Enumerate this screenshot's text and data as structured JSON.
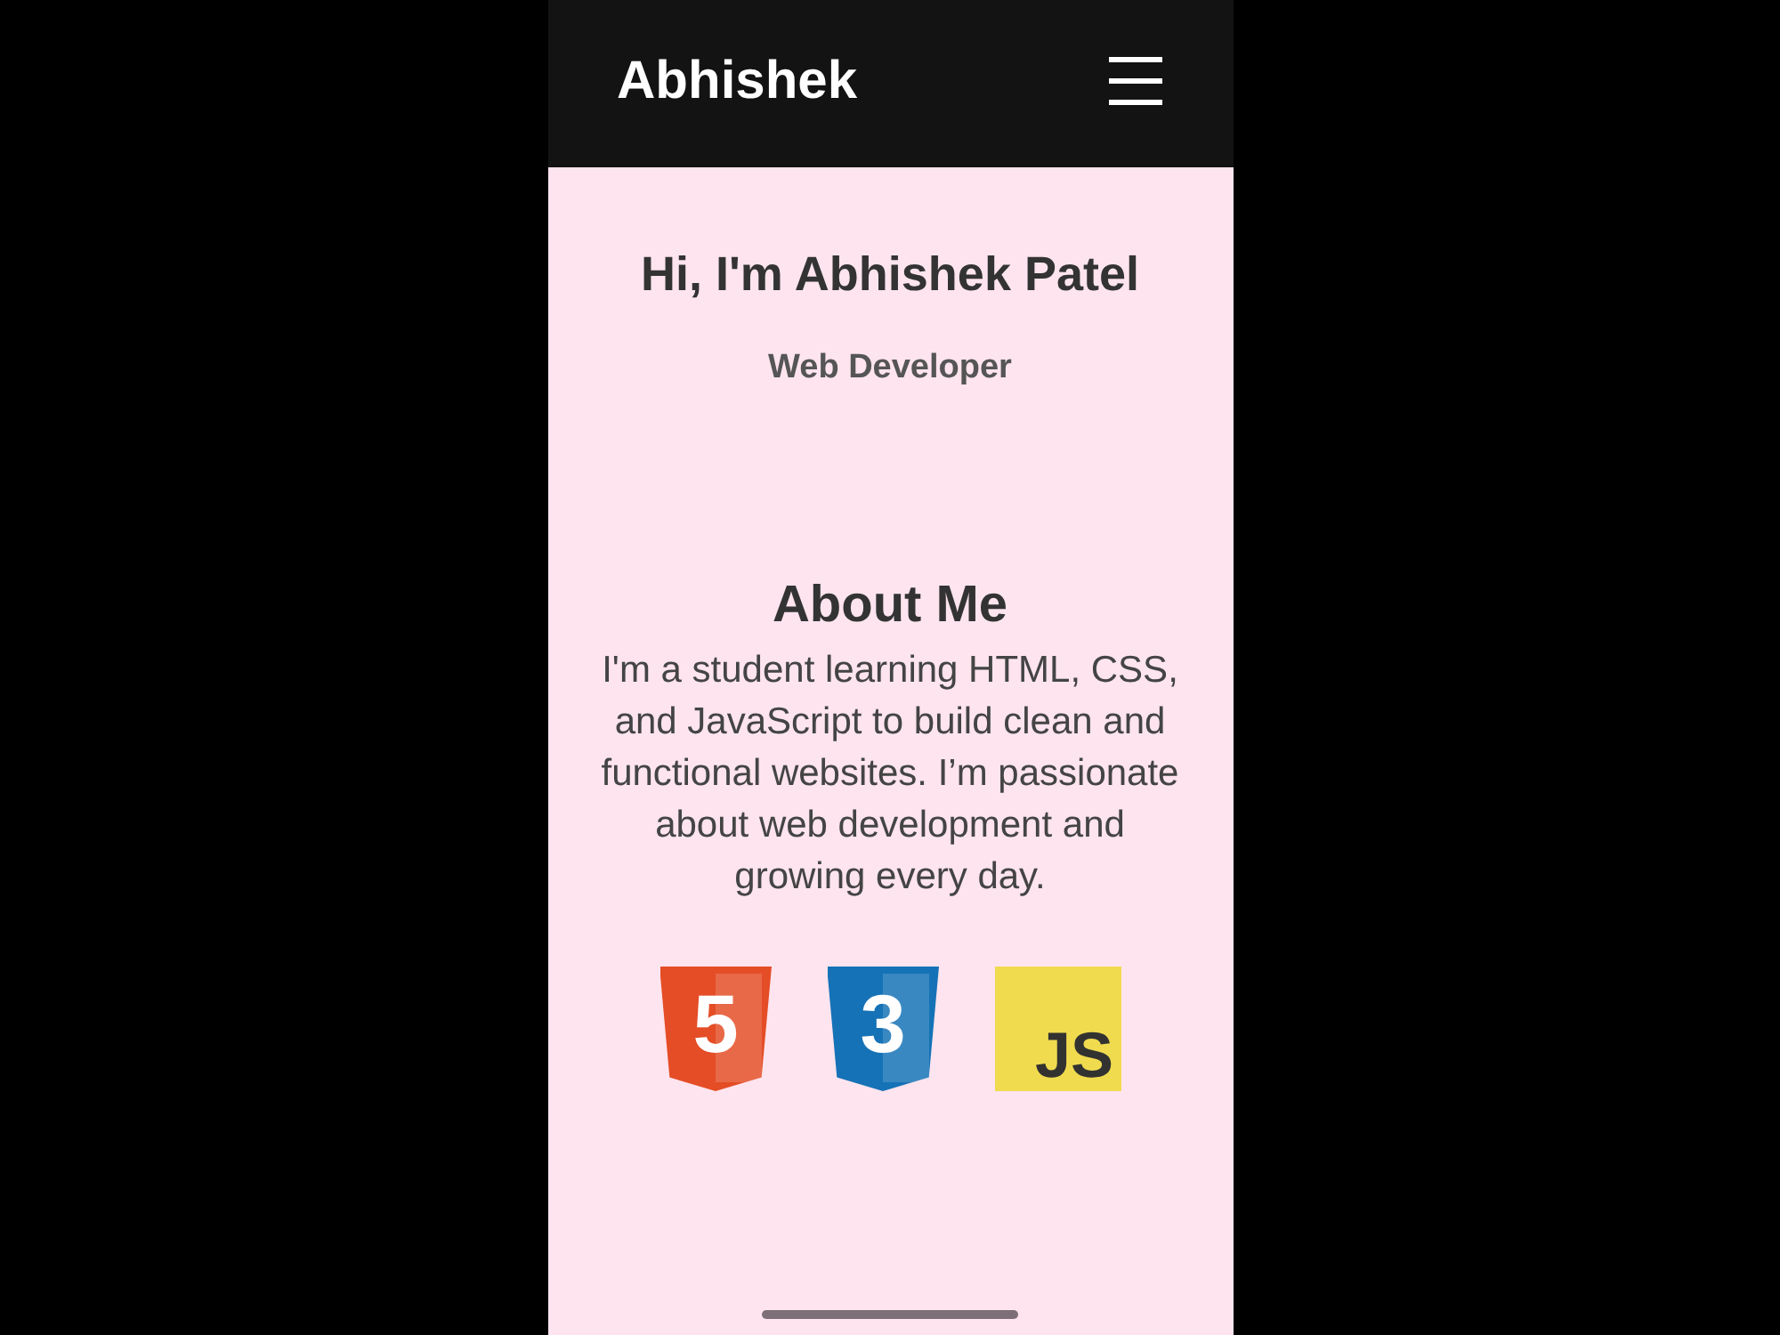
{
  "header": {
    "title": "Abhishek"
  },
  "hero": {
    "heading": "Hi, I'm Abhishek Patel",
    "subtitle": "Web Developer"
  },
  "about": {
    "heading": "About Me",
    "text": "I'm a student learning HTML, CSS, and JavaScript to build clean and functional websites. I’m passionate about web development and growing every day.",
    "logos": [
      {
        "kind": "shield",
        "label": "5",
        "color": "#e44d26"
      },
      {
        "kind": "shield",
        "label": "3",
        "color": "#1572b6"
      },
      {
        "kind": "tile",
        "label": "JS",
        "color": "#f0db4f"
      }
    ]
  }
}
